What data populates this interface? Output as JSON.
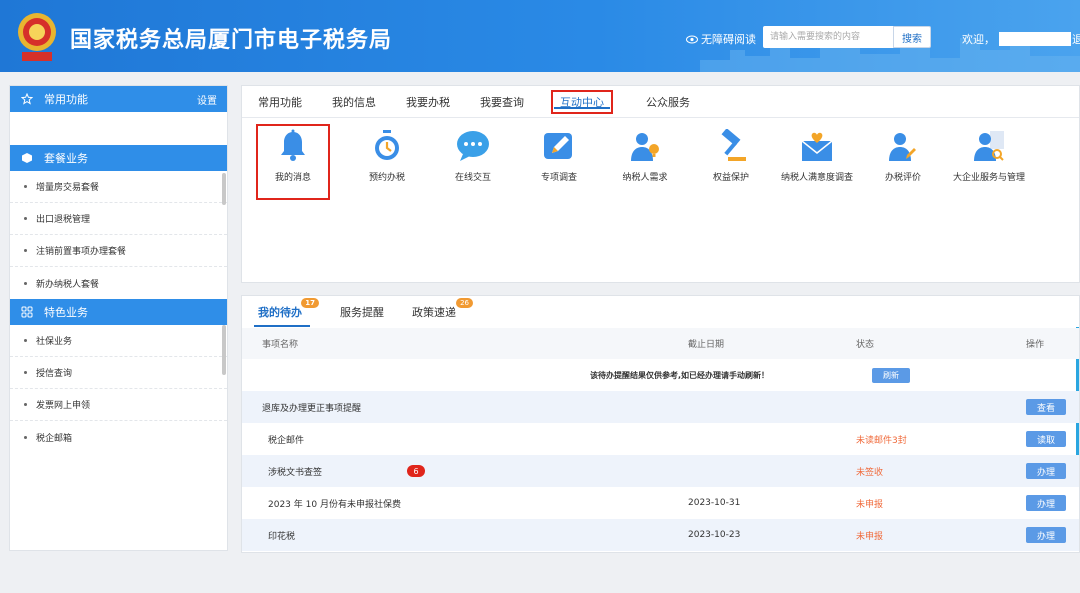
{
  "header": {
    "title": "国家税务总局厦门市电子税务局",
    "accessibility": "无障碍阅读",
    "search_placeholder": "请输入需要搜索的内容",
    "search_button": "搜索",
    "welcome": "欢迎，",
    "tail": "退"
  },
  "sidebar": {
    "common": {
      "label": "常用功能",
      "settings": "设置"
    },
    "package": {
      "label": "套餐业务",
      "items": [
        "增量房交易套餐",
        "出口退税管理",
        "注销前置事项办理套餐",
        "新办纳税人套餐"
      ]
    },
    "special": {
      "label": "特色业务",
      "items": [
        "社保业务",
        "授信查询",
        "发票网上申领",
        "税企邮箱"
      ]
    }
  },
  "top_tabs": [
    "常用功能",
    "我的信息",
    "我要办税",
    "我要查询",
    "互动中心",
    "公众服务"
  ],
  "functions": [
    {
      "label": "我的消息",
      "icon": "bell-icon"
    },
    {
      "label": "预约办税",
      "icon": "stopwatch-icon"
    },
    {
      "label": "在线交互",
      "icon": "chat-icon"
    },
    {
      "label": "专项调查",
      "icon": "edit-icon"
    },
    {
      "label": "纳税人需求",
      "icon": "user-idea-icon"
    },
    {
      "label": "权益保护",
      "icon": "gavel-icon"
    },
    {
      "label": "纳税人满意度调查",
      "icon": "mail-heart-icon"
    },
    {
      "label": "办税评价",
      "icon": "user-edit-icon"
    },
    {
      "label": "大企业服务与管理",
      "icon": "user-search-icon"
    }
  ],
  "todo_tabs": [
    {
      "label": "我的待办",
      "badge": "17"
    },
    {
      "label": "服务提醒",
      "badge": ""
    },
    {
      "label": "政策速递",
      "badge": "26"
    }
  ],
  "table": {
    "headers": {
      "name": "事项名称",
      "date": "截止日期",
      "status": "状态",
      "op": "操作"
    },
    "notice": "该待办提醒结果仅供参考,如已经办理请手动刷新！",
    "refresh": "刷新",
    "rows": [
      {
        "name": "退库及办理更正事项提醒",
        "date": "",
        "status": "",
        "op": "查看",
        "badge": ""
      },
      {
        "name": "税企邮件",
        "date": "",
        "status": "未读邮件3封",
        "op": "读取",
        "badge": ""
      },
      {
        "name": "涉税文书查签",
        "date": "",
        "status": "未签收",
        "op": "办理",
        "badge": "6"
      },
      {
        "name": "2023 年 10 月份有未申报社保费",
        "date": "2023-10-31",
        "status": "未申报",
        "op": "办理",
        "badge": ""
      },
      {
        "name": "印花税",
        "date": "2023-10-23",
        "status": "未申报",
        "op": "办理",
        "badge": ""
      }
    ]
  },
  "colors": {
    "primary": "#2f8ee8",
    "highlight": "#e0251b",
    "warning": "#f06b3c",
    "button": "#5b9ae6"
  }
}
